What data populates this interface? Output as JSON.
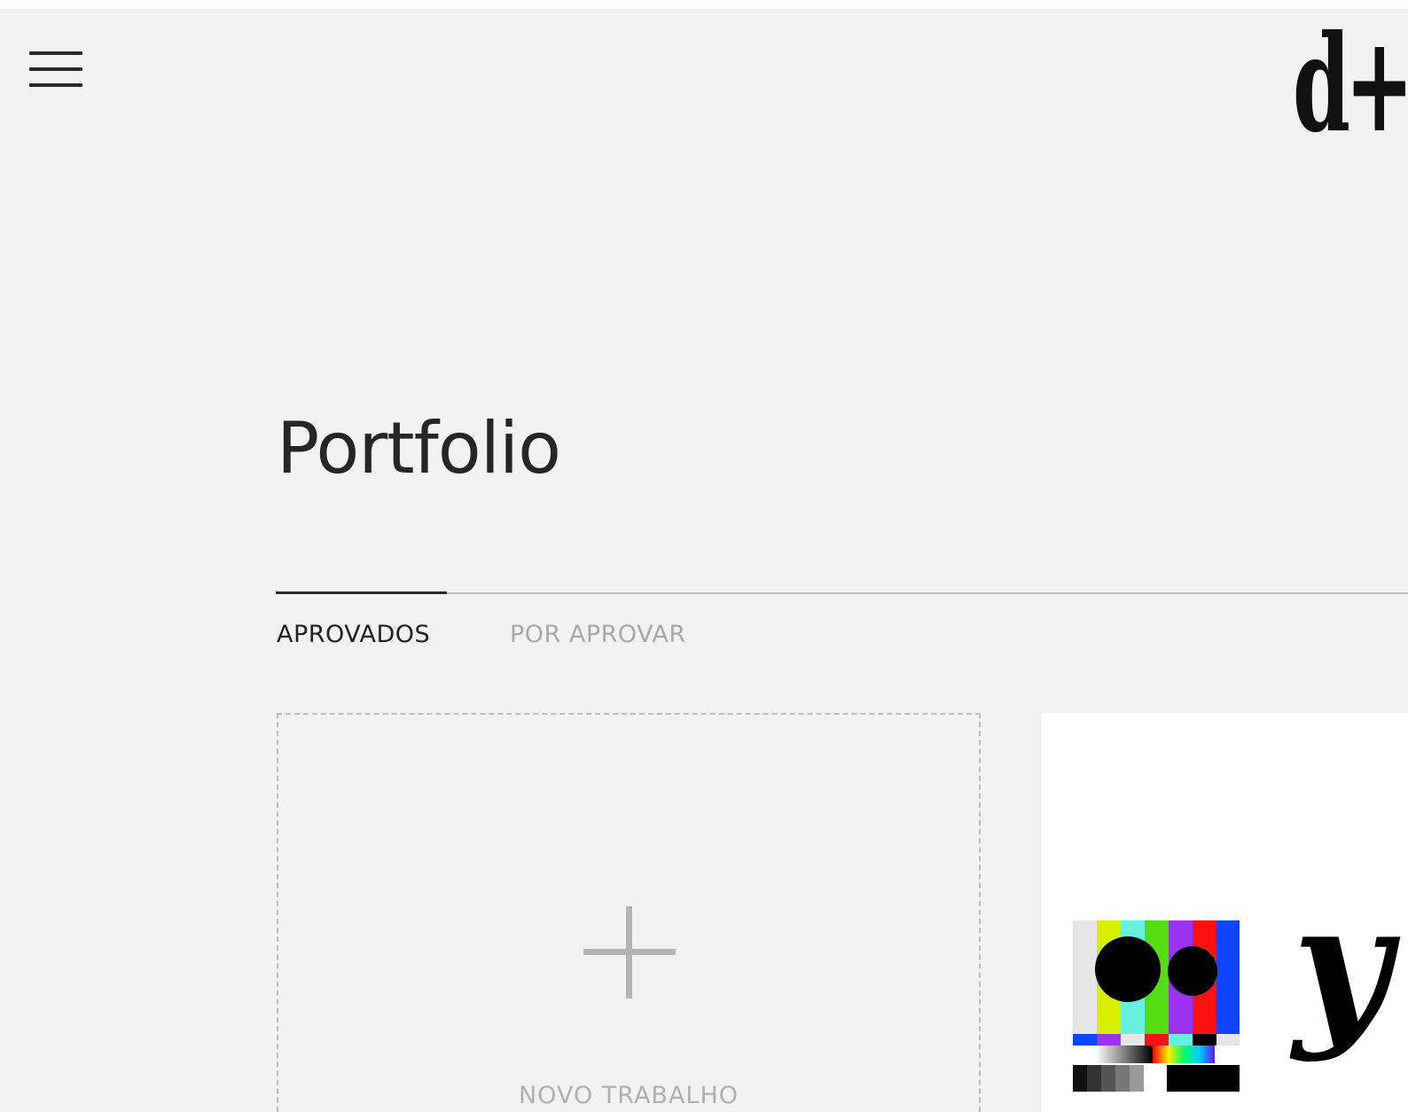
{
  "header": {
    "menu_icon": "hamburger-menu-icon",
    "logo_text": "d+"
  },
  "page": {
    "title": "Portfolio"
  },
  "tabs": [
    {
      "label": "APROVADOS",
      "active": true
    },
    {
      "label": "POR APROVAR",
      "active": false
    }
  ],
  "new_work_card": {
    "icon": "plus-icon",
    "label": "NOVO TRABALHO"
  },
  "project_card": {
    "wordmark": "y",
    "thumbnail": "tv-color-bars-logo"
  },
  "colors": {
    "background": "#f2f2f2",
    "text_dark": "#262626",
    "text_muted": "#a8a8a8",
    "accent_line": "#2a2a2a"
  }
}
